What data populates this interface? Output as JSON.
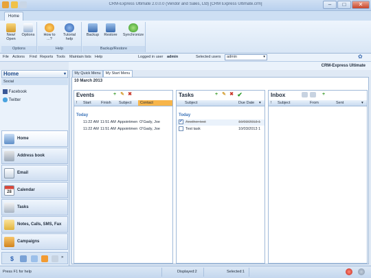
{
  "window": {
    "title": "CRM-Express Ultimate 2.0.0.0 (Vendor and Sales, Ltd) [CRM Express Ultimate.crm]",
    "minimize": "–",
    "maximize": "□",
    "close": "✕"
  },
  "ribbon": {
    "tab_home": "Home",
    "groups": {
      "options": "Options",
      "help": "Help",
      "backup_restore": "Backup/Restore"
    },
    "buttons": {
      "new_open": "New/ Open",
      "options": "Options",
      "how_to": "How to ...?",
      "tutorial": "Tutorial help",
      "backup": "Backup",
      "restore": "Restore",
      "synchronize": "Synchronize"
    }
  },
  "menubar": {
    "file": "File",
    "actions": "Actions",
    "find": "Find",
    "reports": "Reports",
    "tools": "Tools",
    "maintain": "Maintain lists",
    "help": "Help",
    "logged_label": "Logged in user",
    "logged_user": "admin",
    "selected_users_label": "Selected users",
    "selected_users_value": "admin"
  },
  "brand": "CRM-Express Ultimate",
  "sidebar": {
    "header": "Home",
    "social_label": "Social",
    "social_items": [
      "Facebook",
      "Twitter"
    ],
    "nav": [
      "Home",
      "Address book",
      "Email",
      "Calendar",
      "Tasks",
      "Notes, Calls, SMS, Fax",
      "Campaigns"
    ]
  },
  "main": {
    "tabs": [
      "My Quick Menu",
      "My Start Menu"
    ],
    "date": "10 March 2013",
    "events": {
      "title": "Events",
      "columns": [
        "!",
        "Start",
        "Finish",
        "Subject",
        "Contact"
      ],
      "group": "Today",
      "rows": [
        [
          "11:22 AM",
          "11:51 AM",
          "Appointmen",
          "O'Gady, Joe"
        ],
        [
          "11:22 AM",
          "11:51 AM",
          "Appointmen",
          "O'Gady, Joe"
        ]
      ]
    },
    "tasks": {
      "title": "Tasks",
      "columns": [
        "Subject",
        "Due Date"
      ],
      "group": "Today",
      "rows": [
        [
          "Another test",
          "10/03/2013 1",
          "done"
        ],
        [
          "Test task",
          "10/03/2013 1",
          "open"
        ]
      ]
    },
    "inbox": {
      "title": "Inbox",
      "columns": [
        "!",
        "Subject",
        "From",
        "Sent"
      ]
    }
  },
  "status": {
    "help": "Press F1 for help",
    "displayed": "Displayed:2",
    "selected": "Selected:1"
  }
}
